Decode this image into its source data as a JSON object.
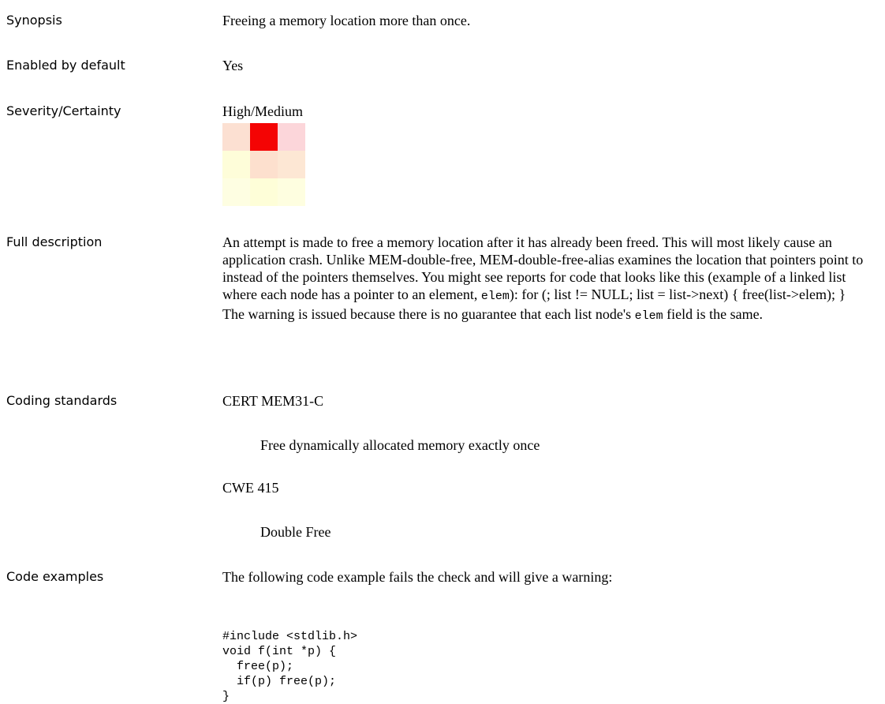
{
  "synopsis": {
    "label": "Synopsis",
    "value": "Freeing a memory location more than once."
  },
  "enabled": {
    "label": "Enabled by default",
    "value": "Yes"
  },
  "severity": {
    "label": "Severity/Certainty",
    "value": "High/Medium",
    "grid_colors": [
      "#fce0d2",
      "#f40404",
      "#fcd6da",
      "#fefdd9",
      "#fde0ce",
      "#fde7d4",
      "#fefee2",
      "#fefed8",
      "#fefee0"
    ]
  },
  "full_description": {
    "label": "Full description",
    "text_1": " An attempt is made to free a memory location after it has already been freed. This will most likely cause an application crash.  Unlike MEM-double-free, MEM-double-free-alias examines the location that pointers point to instead of the pointers themselves. You might see reports for code that looks like this (example of a linked list where each node has a pointer to an element, ",
    "code_1": "elem",
    "text_2": "):  for (; list != NULL; list = list->next) {   free(list->elem); }  The warning is issued because there is no guarantee that each list node's ",
    "code_2": "elem",
    "text_3": " field is the same."
  },
  "coding_standards": {
    "label": "Coding standards",
    "items": [
      {
        "name": "CERT MEM31-C",
        "desc": "Free dynamically allocated memory exactly once"
      },
      {
        "name": "CWE 415",
        "desc": "Double Free"
      }
    ]
  },
  "code_examples": {
    "label": "Code examples",
    "intro": "The following code example fails the check and will give a warning:",
    "code": "#include <stdlib.h>\nvoid f(int *p) {\n  free(p);\n  if(p) free(p);\n}"
  }
}
